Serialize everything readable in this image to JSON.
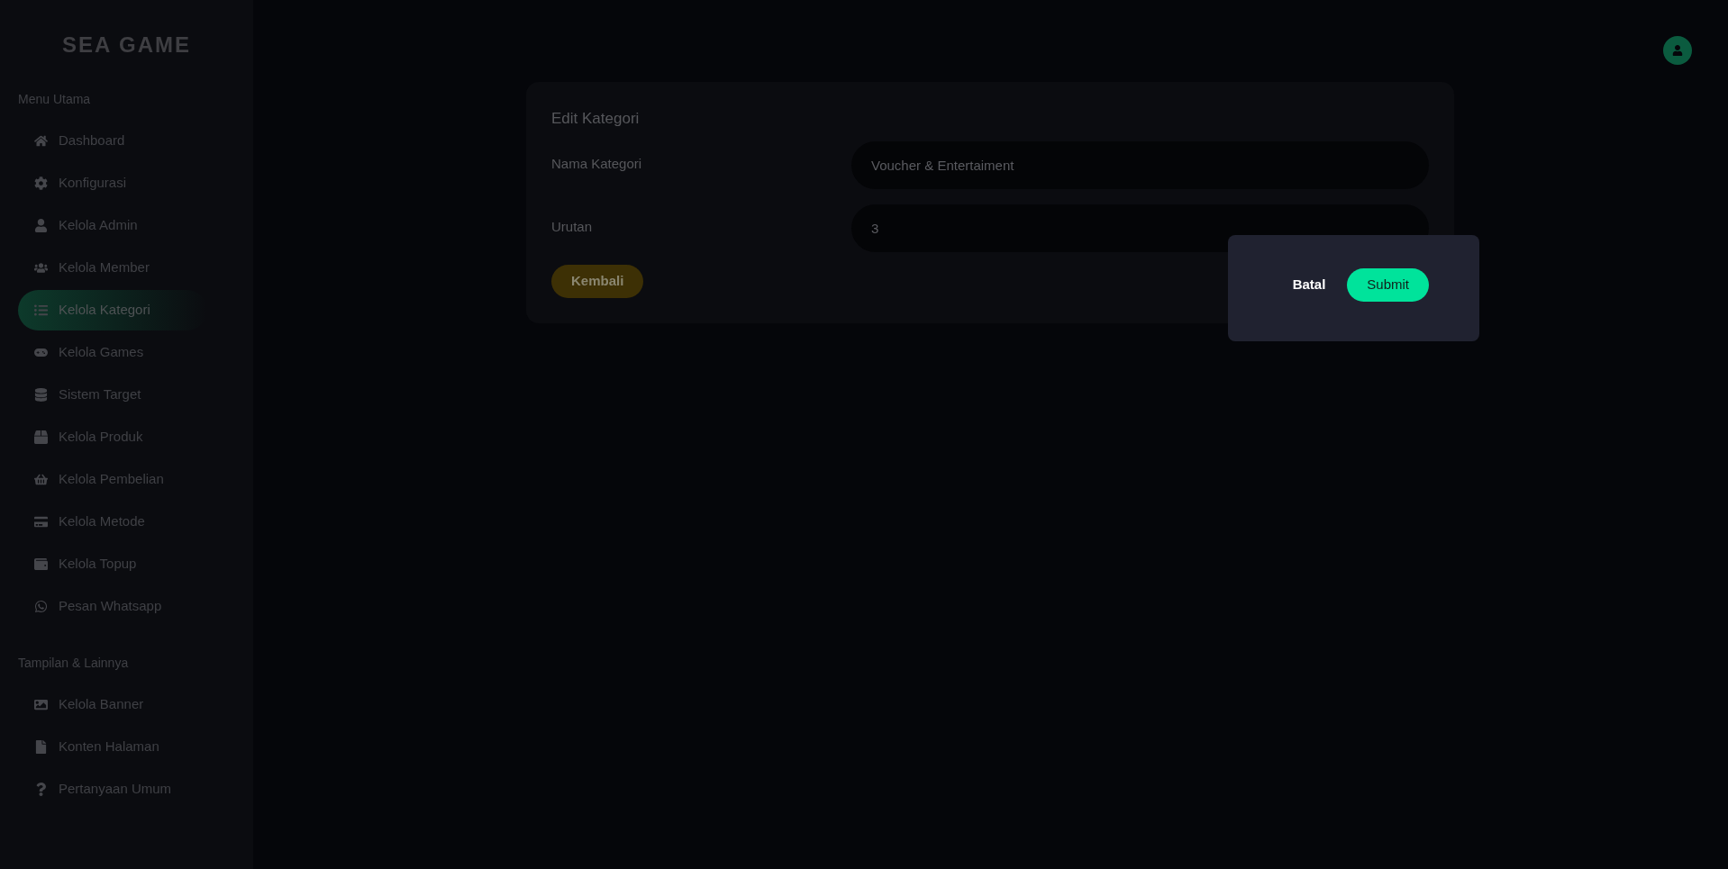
{
  "sidebar": {
    "logo": "SEA GAME",
    "sections": [
      {
        "heading": "Menu Utama",
        "items": [
          {
            "label": "Dashboard",
            "selected": false
          },
          {
            "label": "Konfigurasi",
            "selected": false
          },
          {
            "label": "Kelola Admin",
            "selected": false
          },
          {
            "label": "Kelola Member",
            "selected": false
          },
          {
            "label": "Kelola Kategori",
            "selected": true
          },
          {
            "label": "Kelola Games",
            "selected": false
          },
          {
            "label": "Sistem Target",
            "selected": false
          },
          {
            "label": "Kelola Produk",
            "selected": false
          },
          {
            "label": "Kelola Pembelian",
            "selected": false
          },
          {
            "label": "Kelola Metode",
            "selected": false
          },
          {
            "label": "Kelola Topup",
            "selected": false
          },
          {
            "label": "Pesan Whatsapp",
            "selected": false
          }
        ]
      },
      {
        "heading": "Tampilan & Lainnya",
        "items": [
          {
            "label": "Kelola Banner",
            "selected": false
          },
          {
            "label": "Konten Halaman",
            "selected": false
          },
          {
            "label": "Pertanyaan Umum",
            "selected": false
          }
        ]
      }
    ]
  },
  "form": {
    "title": "Edit Kategori",
    "fields": [
      {
        "label": "Nama Kategori",
        "value": "Voucher & Entertaiment"
      },
      {
        "label": "Urutan",
        "value": "3"
      }
    ],
    "back_button": "Kembali"
  },
  "popup": {
    "cancel": "Batal",
    "submit": "Submit"
  }
}
